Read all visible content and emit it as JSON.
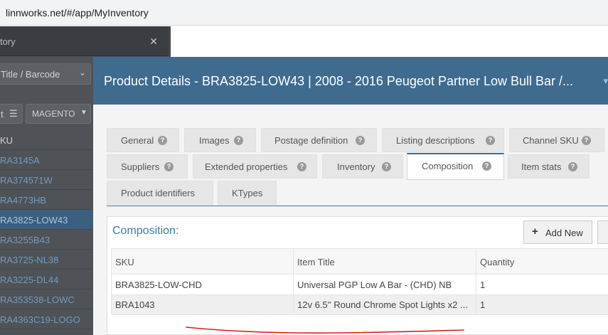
{
  "browser": {
    "url": "linnworks.net/#/app/MyInventory"
  },
  "background_app": {
    "tab_title": "tory",
    "search_field": "Title / Barcode",
    "btn_left": "t",
    "btn_channel": "MAGENTO",
    "list_header": "KU",
    "list_items": [
      "RA3145A",
      "RA374571W",
      "RA4773HB",
      "RA3825-LOW43",
      "RA3255B43",
      "RA3725-NL38",
      "RA3225-DL44",
      "RA353538-LOWC",
      "RA4363C19-LOGO"
    ],
    "selected_index": 3
  },
  "modal": {
    "title": "Product Details - BRA3825-LOW43 | 2008 - 2016 Peugeot Partner Low Bull Bar /...",
    "tabs": [
      {
        "label": "General"
      },
      {
        "label": "Images"
      },
      {
        "label": "Postage definition"
      },
      {
        "label": "Listing descriptions"
      },
      {
        "label": "Channel SKU"
      },
      {
        "label": "Suppliers"
      },
      {
        "label": "Extended properties"
      },
      {
        "label": "Inventory"
      },
      {
        "label": "Composition"
      },
      {
        "label": "Item stats"
      },
      {
        "label": "Product identifiers"
      },
      {
        "label": "KTypes"
      }
    ],
    "active_tab": "Composition",
    "composition": {
      "title": "Composition:",
      "add_new": "Add New",
      "columns": [
        "SKU",
        "Item Title",
        "Quantity"
      ],
      "rows": [
        {
          "sku": "BRA3825-LOW-CHD",
          "title": "Universal PGP Low A Bar - (CHD) NB",
          "quantity": "1"
        },
        {
          "sku": "BRA1043",
          "title": "12v 6.5'' Round Chrome Spot Lights x2 ...",
          "quantity": "1"
        }
      ]
    }
  },
  "annotation": {
    "color": "#d42020"
  },
  "colors": {
    "header_blue": "#3f6b8f",
    "link_blue": "#3f7aa6"
  }
}
